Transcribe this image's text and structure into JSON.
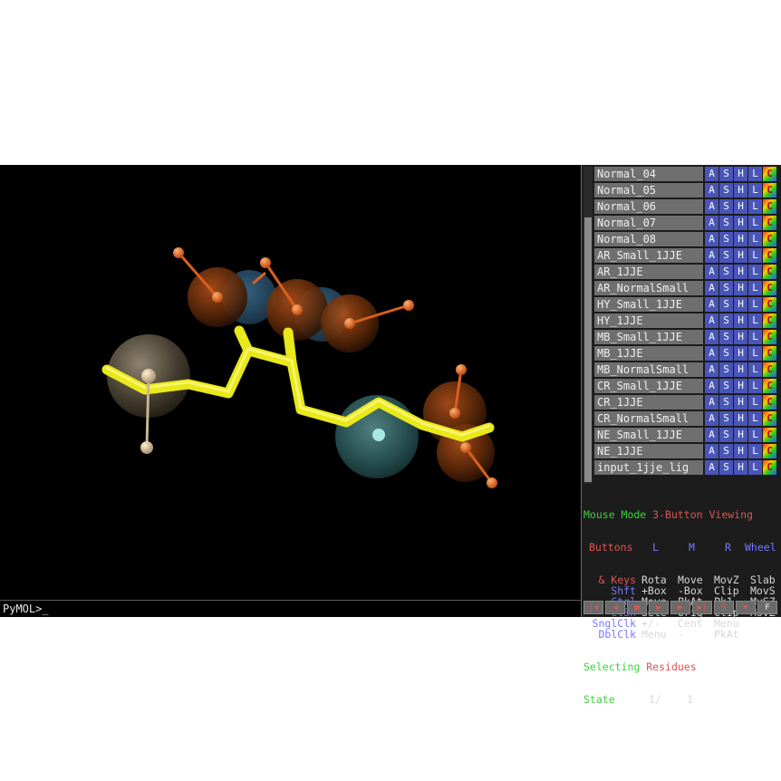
{
  "command_prompt": "PyMOL>_",
  "objects": [
    {
      "name": "Normal_04"
    },
    {
      "name": "Normal_05"
    },
    {
      "name": "Normal_06"
    },
    {
      "name": "Normal_07"
    },
    {
      "name": "Normal_08"
    },
    {
      "name": "AR_Small_1JJE"
    },
    {
      "name": "AR_1JJE"
    },
    {
      "name": "AR_NormalSmall"
    },
    {
      "name": "HY_Small_1JJE"
    },
    {
      "name": "HY_1JJE"
    },
    {
      "name": "MB_Small_1JJE"
    },
    {
      "name": "MB_1JJE"
    },
    {
      "name": "MB_NormalSmall"
    },
    {
      "name": "CR_Small_1JJE"
    },
    {
      "name": "CR_1JJE"
    },
    {
      "name": "CR_NormalSmall"
    },
    {
      "name": "NE_Small_1JJE"
    },
    {
      "name": "NE_1JJE"
    },
    {
      "name": "input_1jje_lig"
    }
  ],
  "object_buttons": {
    "a": "A",
    "s": "S",
    "h": "H",
    "l": "L",
    "c": "C"
  },
  "mouse_help": {
    "title_prefix": "Mouse Mode ",
    "title_mode": "3-Button Viewing",
    "buttons_label": "Buttons",
    "keys_label": "& Keys",
    "col_l": "L",
    "col_m": "M",
    "col_r": "R",
    "col_wheel": "Wheel",
    "rows": [
      {
        "mod": "",
        "l": "Rota",
        "m": "Move",
        "r": "MovZ",
        "w": "Slab"
      },
      {
        "mod": "Shft",
        "l": "+Box",
        "m": "-Box",
        "r": "Clip",
        "w": "MovS"
      },
      {
        "mod": "Ctrl",
        "l": "Move",
        "m": "PkAt",
        "r": "Pk1",
        "w": "MvSZ"
      },
      {
        "mod": "CtSh",
        "l": "Sele",
        "m": "Orig",
        "r": "Clip",
        "w": "MovZ"
      },
      {
        "mod": "SnglClk",
        "l": "+/-",
        "m": "Cent",
        "r": "Menu",
        "w": ""
      },
      {
        "mod": "DblClk",
        "l": "Menu",
        "m": "-",
        "r": "PkAt",
        "w": ""
      }
    ],
    "selecting_label": "Selecting",
    "selecting_value": "Residues",
    "state_label": "State",
    "state_value": "1/",
    "state_total": "1"
  },
  "playback": [
    {
      "icon": "rewind-icon",
      "glyph": "|◀"
    },
    {
      "icon": "back-icon",
      "glyph": "◀"
    },
    {
      "icon": "stop-icon",
      "glyph": "■"
    },
    {
      "icon": "play-icon",
      "glyph": "▶"
    },
    {
      "icon": "forward-icon",
      "glyph": "▶"
    },
    {
      "icon": "fastforward-icon",
      "glyph": "▶|"
    },
    {
      "icon": "scene-icon",
      "glyph": "S"
    },
    {
      "icon": "dropdown-icon",
      "glyph": "▼"
    },
    {
      "icon": "fullscreen-icon",
      "glyph": "F"
    }
  ],
  "colors": {
    "background": "#000000",
    "stick": "#f0f020",
    "orange_atom": "#e8641e",
    "teal_sphere": "#5ab4b4",
    "tan_sphere": "#bfaa88"
  }
}
